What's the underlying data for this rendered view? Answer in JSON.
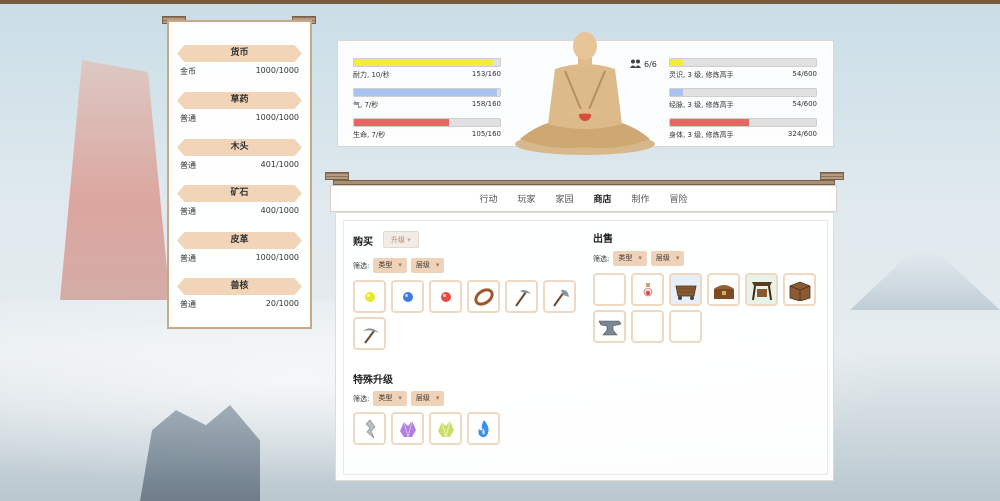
{
  "resources": {
    "groups": [
      {
        "header": "货币",
        "name": "金币",
        "value": "1000/1000"
      },
      {
        "header": "草药",
        "name": "普通",
        "value": "1000/1000"
      },
      {
        "header": "木头",
        "name": "普通",
        "value": "401/1000"
      },
      {
        "header": "矿石",
        "name": "普通",
        "value": "400/1000"
      },
      {
        "header": "皮革",
        "name": "普通",
        "value": "1000/1000"
      },
      {
        "header": "兽核",
        "name": "普通",
        "value": "20/1000"
      }
    ]
  },
  "stats": {
    "left": [
      {
        "label": "耐力, 10/秒",
        "value": "153/160",
        "fill": 0.95,
        "color": "#f2ee3a"
      },
      {
        "label": "气, 7/秒",
        "value": "158/160",
        "fill": 0.98,
        "color": "#a9c3f0"
      },
      {
        "label": "生命, 7/秒",
        "value": "105/160",
        "fill": 0.65,
        "color": "#e06a62"
      }
    ],
    "right": [
      {
        "label": "灵识, 3 级, 修炼高手",
        "value": "54/600",
        "fill": 0.09,
        "color": "#f2ee3a"
      },
      {
        "label": "经脉, 3 级, 修炼高手",
        "value": "54/600",
        "fill": 0.09,
        "color": "#a9c3f0"
      },
      {
        "label": "身体, 3 级, 修炼高手",
        "value": "324/600",
        "fill": 0.54,
        "color": "#e06a62"
      }
    ],
    "capacity": "6/6"
  },
  "tabs": [
    "行动",
    "玩家",
    "家园",
    "商店",
    "制作",
    "冒险"
  ],
  "active_tab": "商店",
  "buy": {
    "title": "购买",
    "upgrade_label": "升级",
    "filter_label": "筛选:",
    "type_label": "类型",
    "tier_label": "层级",
    "items": [
      "yellow-orb-icon",
      "blue-orb-icon",
      "red-orb-icon",
      "bracelet-icon",
      "scythe-icon",
      "axe-icon",
      "pickaxe-icon"
    ]
  },
  "special": {
    "title": "特殊升级",
    "filter_label": "筛选:",
    "type_label": "类型",
    "tier_label": "层级",
    "items": [
      "silver-shard-icon",
      "purple-crystal-icon",
      "green-crystal-icon",
      "blue-flame-icon"
    ]
  },
  "sell": {
    "title": "出售",
    "filter_label": "筛选:",
    "type_label": "类型",
    "tier_label": "层级",
    "items": [
      "empty",
      "potion-icon",
      "cart-icon",
      "treasure-chest-icon",
      "forge-stand-icon",
      "wooden-crate-icon",
      "anvil-icon",
      "empty",
      "empty"
    ]
  }
}
